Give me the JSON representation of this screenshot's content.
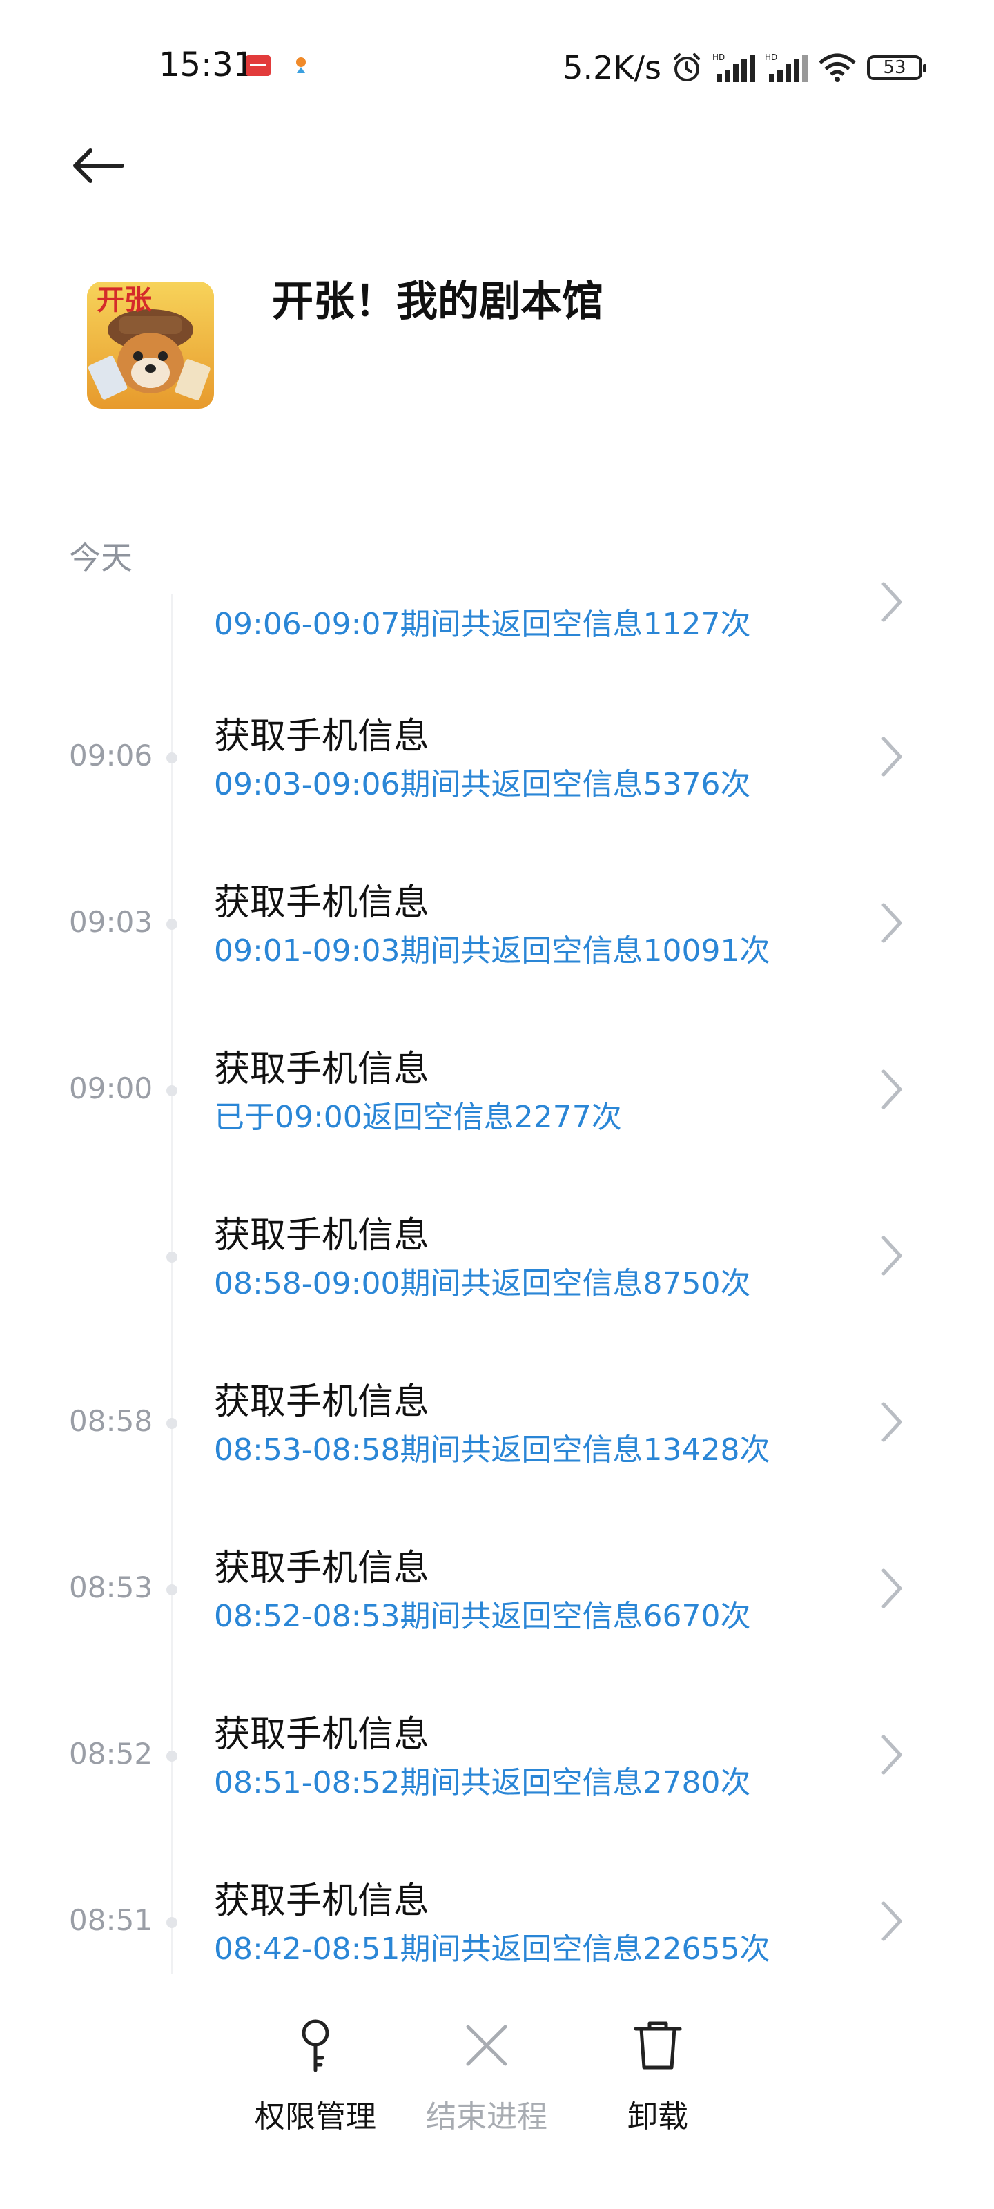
{
  "status_bar": {
    "time": "15:31",
    "network_speed": "5.2K/s",
    "battery": "53"
  },
  "app": {
    "name": "开张！我的剧本馆",
    "icon_text": "开张"
  },
  "section": {
    "title": "今天"
  },
  "records": [
    {
      "time": "",
      "title": "",
      "detail": "09:06-09:07期间共返回空信息1127次"
    },
    {
      "time": "09:06",
      "title": "获取手机信息",
      "detail": "09:03-09:06期间共返回空信息5376次"
    },
    {
      "time": "09:03",
      "title": "获取手机信息",
      "detail": "09:01-09:03期间共返回空信息10091次"
    },
    {
      "time": "09:00",
      "title": "获取手机信息",
      "detail": "已于09:00返回空信息2277次"
    },
    {
      "time": "",
      "title": "获取手机信息",
      "detail": "08:58-09:00期间共返回空信息8750次"
    },
    {
      "time": "08:58",
      "title": "获取手机信息",
      "detail": "08:53-08:58期间共返回空信息13428次"
    },
    {
      "time": "08:53",
      "title": "获取手机信息",
      "detail": "08:52-08:53期间共返回空信息6670次"
    },
    {
      "time": "08:52",
      "title": "获取手机信息",
      "detail": "08:51-08:52期间共返回空信息2780次"
    },
    {
      "time": "08:51",
      "title": "获取手机信息",
      "detail": "08:42-08:51期间共返回空信息22655次"
    }
  ],
  "bottom_actions": {
    "permissions": "权限管理",
    "kill": "结束进程",
    "uninstall": "卸载"
  },
  "colors": {
    "accent": "#2a86d6",
    "muted": "#9a9ea6",
    "disabled": "#a8acb2"
  }
}
